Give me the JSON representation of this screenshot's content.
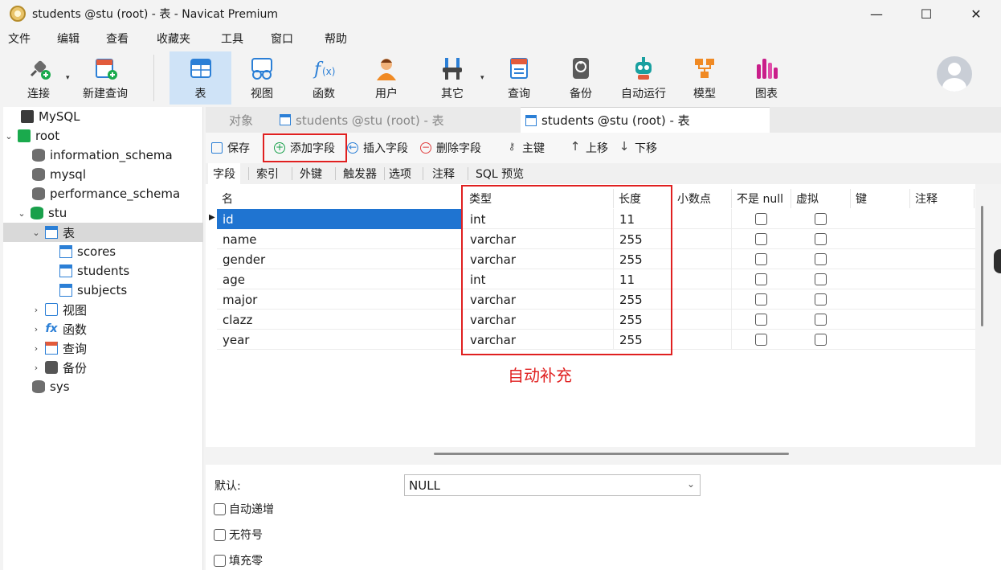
{
  "window": {
    "title": "students @stu (root) - 表 - Navicat Premium",
    "minimize": "—",
    "maximize": "☐",
    "close": "✕"
  },
  "menu": [
    "文件",
    "编辑",
    "查看",
    "收藏夹",
    "工具",
    "窗口",
    "帮助"
  ],
  "toolbar": {
    "connect": "连接",
    "new_query": "新建查询",
    "table": "表",
    "view": "视图",
    "function": "函数",
    "user": "用户",
    "other": "其它",
    "query": "查询",
    "backup": "备份",
    "automation": "自动运行",
    "model": "模型",
    "chart": "图表"
  },
  "tree": {
    "mysql": "MySQL",
    "root": "root",
    "information_schema": "information_schema",
    "mysql_db": "mysql",
    "performance_schema": "performance_schema",
    "stu": "stu",
    "tables": "表",
    "scores": "scores",
    "students": "students",
    "subjects": "subjects",
    "views": "视图",
    "functions": "函数",
    "queries": "查询",
    "backups": "备份",
    "sys": "sys"
  },
  "tabs": {
    "objects": "对象",
    "tab1": "students @stu (root) - 表",
    "tab2": "students @stu (root) - 表"
  },
  "actions": {
    "save": "保存",
    "add_field": "添加字段",
    "insert_field": "插入字段",
    "delete_field": "删除字段",
    "primary_key": "主键",
    "move_up": "上移",
    "move_down": "下移"
  },
  "subtabs": [
    "字段",
    "索引",
    "外键",
    "触发器",
    "选项",
    "注释",
    "SQL 预览"
  ],
  "grid": {
    "headers": {
      "name": "名",
      "type": "类型",
      "length": "长度",
      "decimals": "小数点",
      "not_null": "不是 null",
      "virtual": "虚拟",
      "key": "键",
      "comment": "注释"
    },
    "rows": [
      {
        "name": "id",
        "type": "int",
        "length": "11"
      },
      {
        "name": "name",
        "type": "varchar",
        "length": "255"
      },
      {
        "name": "gender",
        "type": "varchar",
        "length": "255"
      },
      {
        "name": "age",
        "type": "int",
        "length": "11"
      },
      {
        "name": "major",
        "type": "varchar",
        "length": "255"
      },
      {
        "name": "clazz",
        "type": "varchar",
        "length": "255"
      },
      {
        "name": "year",
        "type": "varchar",
        "length": "255"
      }
    ]
  },
  "annotation": "自动补充",
  "properties": {
    "default_label": "默认:",
    "default_value": "NULL",
    "auto_increment": "自动递增",
    "unsigned": "无符号",
    "zerofill": "填充零"
  },
  "colors": {
    "accent": "#1f74d1",
    "annotation": "#e02020",
    "active_tool": "#cfe3f7"
  }
}
